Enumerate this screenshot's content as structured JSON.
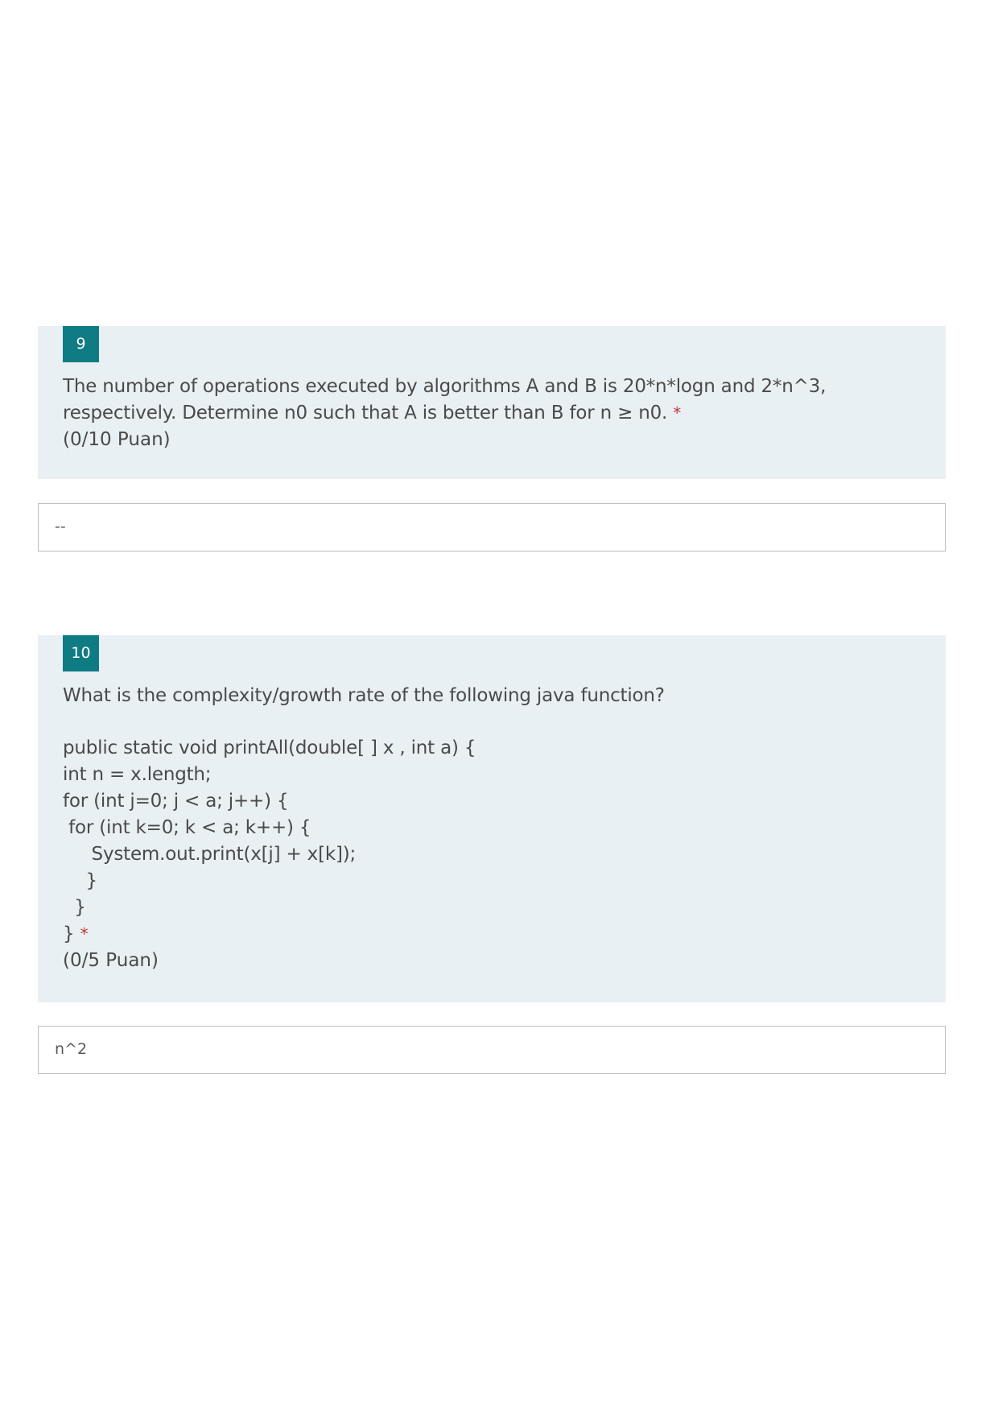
{
  "questions": [
    {
      "number": "9",
      "text": "The number of operations executed by algorithms A and B is 20*n*logn and 2*n^3,\nrespectively. Determine n0 such that A is better than B for n ≥ n0.",
      "required_mark": "*",
      "points": "(0/10 Puan)",
      "answer": "--"
    },
    {
      "number": "10",
      "text": "What is the complexity/growth rate of the following java function?",
      "code": "public static void printAll(double[ ] x , int a) {\nint n = x.length;\nfor (int j=0; j < a; j++) {\n for (int k=0; k < a; k++) {\n     System.out.print(x[j] + x[k]);\n    }\n  }\n}",
      "required_mark": "*",
      "points": "(0/5 Puan)",
      "answer": "n^2"
    }
  ]
}
